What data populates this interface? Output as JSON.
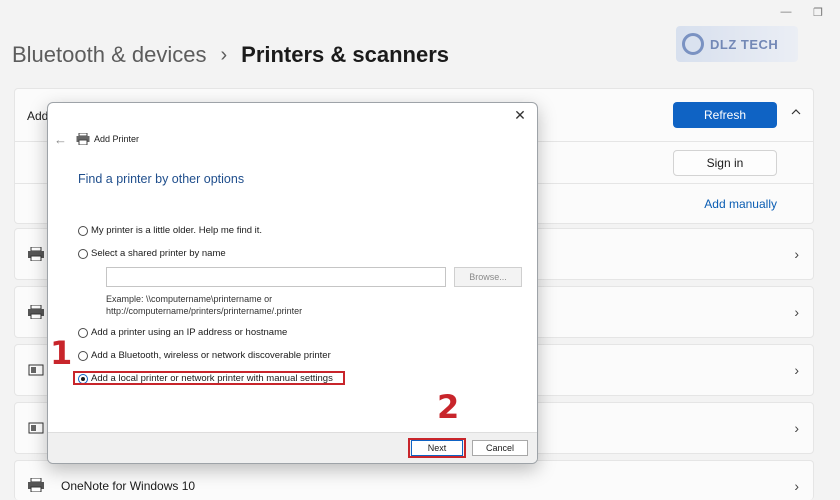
{
  "header": {
    "parent": "Bluetooth & devices",
    "separator": "›",
    "current": "Printers & scanners"
  },
  "window_controls": {
    "minimize": "—",
    "restore": "❐"
  },
  "logo": {
    "text": "DLZ TECH"
  },
  "top_card": {
    "add_label": "Add",
    "refresh_label": "Refresh",
    "signin_label": "Sign in",
    "add_manually_label": "Add manually"
  },
  "printers": [
    {
      "name": ""
    },
    {
      "name": ""
    },
    {
      "name": ""
    },
    {
      "name": ""
    },
    {
      "name": "OneNote for Windows 10"
    }
  ],
  "dialog": {
    "title": "Add Printer",
    "heading": "Find a printer by other options",
    "options": [
      {
        "label": "My printer is a little older. Help me find it.",
        "checked": false
      },
      {
        "label": "Select a shared printer by name",
        "checked": false
      },
      {
        "label": "Add a printer using an IP address or hostname",
        "checked": false
      },
      {
        "label": "Add a Bluetooth, wireless or network discoverable printer",
        "checked": false
      },
      {
        "label": "Add a local printer or network printer with manual settings",
        "checked": true
      }
    ],
    "share_input_value": "",
    "browse_label": "Browse...",
    "example_line1": "Example: \\\\computername\\printername or",
    "example_line2": "http://computername/printers/printername/.printer",
    "next_label": "Next",
    "cancel_label": "Cancel"
  },
  "annotations": {
    "step1": "1",
    "step2": "2"
  },
  "colors": {
    "accent": "#0f63c4",
    "highlight": "#c8252b",
    "heading": "#1f4e8c"
  }
}
